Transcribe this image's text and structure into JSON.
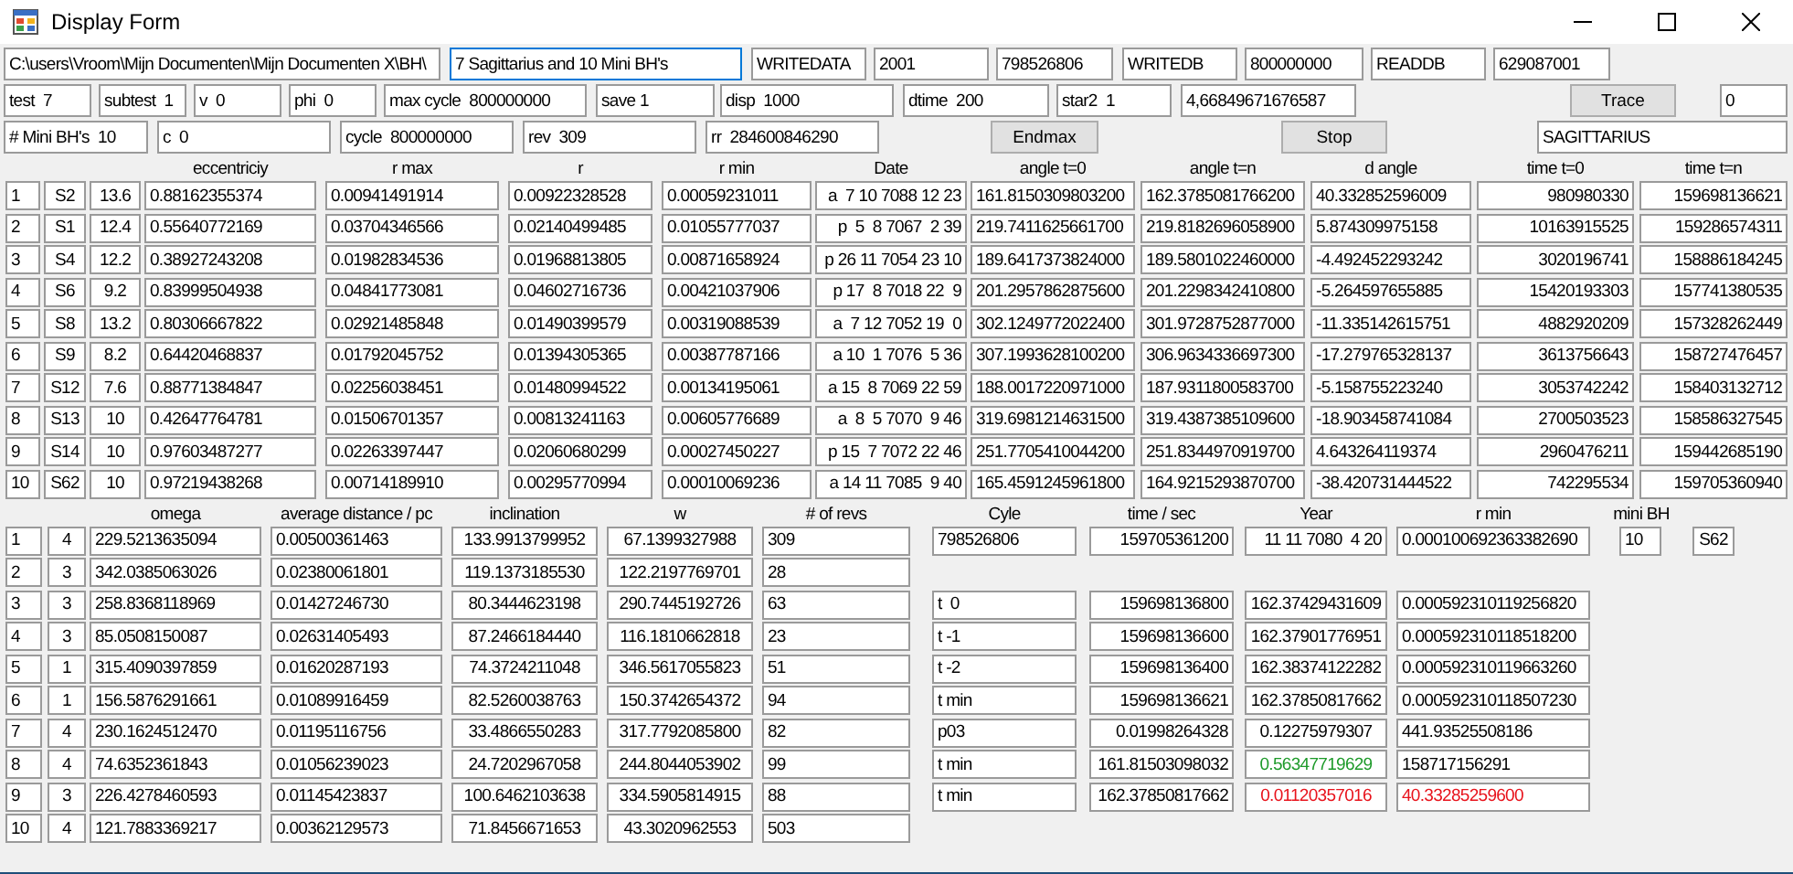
{
  "window": {
    "title": "Display Form"
  },
  "top_rows": [
    [
      {
        "kind": "field",
        "value": "C:\\users\\Vroom\\Mijn Documenten\\Mijn Documenten X\\BH\\",
        "focused": false
      },
      {
        "kind": "field",
        "value": "7 Sagittarius and 10 Mini BH's",
        "focused": true
      },
      {
        "kind": "field",
        "value": "WRITEDATA",
        "focused": false
      },
      {
        "kind": "field",
        "value": "2001",
        "focused": false
      },
      {
        "kind": "field",
        "value": "798526806",
        "focused": false
      },
      {
        "kind": "field",
        "value": "WRITEDB",
        "focused": false
      },
      {
        "kind": "field",
        "value": "800000000",
        "focused": false
      },
      {
        "kind": "field",
        "value": "READDB",
        "focused": false
      },
      {
        "kind": "field",
        "value": "629087001",
        "focused": false
      }
    ],
    [
      {
        "kind": "field",
        "value": "test  7",
        "focused": false
      },
      {
        "kind": "field",
        "value": "subtest  1",
        "focused": false
      },
      {
        "kind": "field",
        "value": "v  0",
        "focused": false
      },
      {
        "kind": "field",
        "value": "phi  0",
        "focused": false
      },
      {
        "kind": "field",
        "value": "max cycle  800000000",
        "focused": false
      },
      {
        "kind": "field",
        "value": "save 1",
        "focused": false
      },
      {
        "kind": "field",
        "value": "disp  1000",
        "focused": false
      },
      {
        "kind": "field",
        "value": "dtime  200",
        "focused": false
      },
      {
        "kind": "field",
        "value": "star2  1",
        "focused": false
      },
      {
        "kind": "field",
        "value": "4,66849671676587",
        "focused": false
      },
      {
        "kind": "button",
        "value": "Trace"
      },
      {
        "kind": "field",
        "value": "0",
        "focused": false
      }
    ],
    [
      {
        "kind": "field",
        "value": "# Mini BH's  10",
        "focused": false
      },
      {
        "kind": "field",
        "value": "c  0",
        "focused": false
      },
      {
        "kind": "field",
        "value": "cycle  800000000",
        "focused": false
      },
      {
        "kind": "field",
        "value": "rev  309",
        "focused": false
      },
      {
        "kind": "field",
        "value": "rr  284600846290",
        "focused": false
      },
      {
        "kind": "button",
        "value": "Endmax"
      },
      {
        "kind": "button",
        "value": "Stop"
      },
      {
        "kind": "field",
        "value": "SAGITTARIUS",
        "focused": false
      }
    ]
  ],
  "stars_table": {
    "headers": [
      "eccentriciy",
      "r max",
      "r",
      "r min",
      "Date",
      "angle t=0",
      "angle t=n",
      "d angle",
      "time t=0",
      "time t=n"
    ],
    "rows": [
      [
        "1",
        "S2",
        "13.6",
        "0.88162355374",
        "0.00941491914",
        "0.00922328528",
        "0.00059231011",
        "a  7 10 7088 12 23",
        "161.8150309803200",
        "162.3785081766200",
        "40.332852596009",
        "980980330",
        "159698136621"
      ],
      [
        "2",
        "S1",
        "12.4",
        "0.55640772169",
        "0.03704346566",
        "0.02140499485",
        "0.01055777037",
        "p  5  8 7067  2 39",
        "219.7411625661700",
        "219.8182696058900",
        "5.874309975158",
        "10163915525",
        "159286574311"
      ],
      [
        "3",
        "S4",
        "12.2",
        "0.38927243208",
        "0.01982834536",
        "0.01968813805",
        "0.00871658924",
        "p 26 11 7054 23 10",
        "189.6417373824000",
        "189.5801022460000",
        "-4.492452293242",
        "3020196741",
        "158886184245"
      ],
      [
        "4",
        "S6",
        "9.2",
        "0.83999504938",
        "0.04841773081",
        "0.04602716736",
        "0.00421037906",
        "p 17  8 7018 22  9",
        "201.2957862875600",
        "201.2298342410800",
        "-5.264597655885",
        "15420193303",
        "157741380535"
      ],
      [
        "5",
        "S8",
        "13.2",
        "0.80306667822",
        "0.02921485848",
        "0.01490399579",
        "0.00319088539",
        "a  7 12 7052 19  0",
        "302.1249772022400",
        "301.9728752877000",
        "-11.335142615751",
        "4882920209",
        "157328262449"
      ],
      [
        "6",
        "S9",
        "8.2",
        "0.64420468837",
        "0.01792045752",
        "0.01394305365",
        "0.00387787166",
        "a 10  1 7076  5 36",
        "307.1993628100200",
        "306.9634336697300",
        "-17.279765328137",
        "3613756643",
        "158727476457"
      ],
      [
        "7",
        "S12",
        "7.6",
        "0.88771384847",
        "0.02256038451",
        "0.01480994522",
        "0.00134195061",
        "a 15  8 7069 22 59",
        "188.0017220971000",
        "187.9311800583700",
        "-5.158755223240",
        "3053742242",
        "158403132712"
      ],
      [
        "8",
        "S13",
        "10",
        "0.42647764781",
        "0.01506701357",
        "0.00813241163",
        "0.00605776689",
        "a  8  5 7070  9 46",
        "319.6981214631500",
        "319.4387385109600",
        "-18.903458741084",
        "2700503523",
        "158586327545"
      ],
      [
        "9",
        "S14",
        "10",
        "0.97603487277",
        "0.02263397447",
        "0.02060680299",
        "0.00027450227",
        "p 15  7 7072 22 46",
        "251.7705410044200",
        "251.8344970919700",
        "4.643264119374",
        "2960476211",
        "159442685190"
      ],
      [
        "10",
        "S62",
        "10",
        "0.97219438268",
        "0.00714189910",
        "0.00295770994",
        "0.00010069236",
        "a 14 11 7085  9 40",
        "165.4591245961800",
        "164.9215293870700",
        "-38.420731444522",
        "742295534",
        "159705360940"
      ]
    ]
  },
  "orbits_table": {
    "headers": [
      "omega",
      "average distance / pc",
      "inclination",
      "w",
      "# of revs"
    ],
    "rows": [
      [
        "1",
        "4",
        "229.5213635094",
        "0.00500361463",
        "133.9913799952",
        "67.1399327988",
        "309"
      ],
      [
        "2",
        "3",
        "342.0385063026",
        "0.02380061801",
        "119.1373185530",
        "122.2197769701",
        "28"
      ],
      [
        "3",
        "3",
        "258.8368118969",
        "0.01427246730",
        "80.3444623198",
        "290.7445192726",
        "63"
      ],
      [
        "4",
        "3",
        "85.0508150087",
        "0.02631405493",
        "87.2466184440",
        "116.1810662818",
        "23"
      ],
      [
        "5",
        "1",
        "315.4090397859",
        "0.01620287193",
        "74.3724211048",
        "346.5617055823",
        "51"
      ],
      [
        "6",
        "1",
        "156.5876291661",
        "0.01089916459",
        "82.5260038763",
        "150.3742654372",
        "94"
      ],
      [
        "7",
        "4",
        "230.1624512470",
        "0.01195116756",
        "33.4866550283",
        "317.7792085800",
        "82"
      ],
      [
        "8",
        "4",
        "74.6352361843",
        "0.01056239023",
        "24.7202967058",
        "244.8044053902",
        "99"
      ],
      [
        "9",
        "3",
        "226.4278460593",
        "0.01145423837",
        "100.6462103638",
        "334.5905814915",
        "88"
      ],
      [
        "10",
        "4",
        "121.7883369217",
        "0.00362129573",
        "71.8456671653",
        "43.3020962553",
        "503"
      ]
    ]
  },
  "closest_approach": {
    "headers": [
      "Cyle",
      "time / sec",
      "Year",
      "r min",
      "mini BH"
    ],
    "summary": [
      "798526806",
      "159705361200",
      "11 11 7080  4 20",
      "0.000100692363382690",
      "10",
      "S62"
    ],
    "rows": [
      [
        {
          "text": "t  0"
        },
        {
          "text": "159698136800"
        },
        {
          "text": "162.37429431609"
        },
        {
          "text": "0.000592310119256820"
        }
      ],
      [
        {
          "text": "t -1"
        },
        {
          "text": "159698136600"
        },
        {
          "text": "162.37901776951"
        },
        {
          "text": "0.000592310118518200"
        }
      ],
      [
        {
          "text": "t -2"
        },
        {
          "text": "159698136400"
        },
        {
          "text": "162.38374122282"
        },
        {
          "text": "0.000592310119663260"
        }
      ],
      [
        {
          "text": "t min"
        },
        {
          "text": "159698136621"
        },
        {
          "text": "162.37850817662"
        },
        {
          "text": "0.000592310118507230"
        }
      ],
      [
        {
          "text": "p03"
        },
        {
          "text": "0.01998264328"
        },
        {
          "text": "0.12275979307"
        },
        {
          "text": "441.93525508186"
        }
      ],
      [
        {
          "text": "t min"
        },
        {
          "text": "161.81503098032"
        },
        {
          "text": "0.56347719629",
          "color": "#1e9a2a"
        },
        {
          "text": "158717156291"
        }
      ],
      [
        {
          "text": "t min"
        },
        {
          "text": "162.37850817662"
        },
        {
          "text": "0.01120357016",
          "color": "#e8121b"
        },
        {
          "text": "40.33285259600",
          "color": "#e8121b"
        }
      ]
    ]
  }
}
